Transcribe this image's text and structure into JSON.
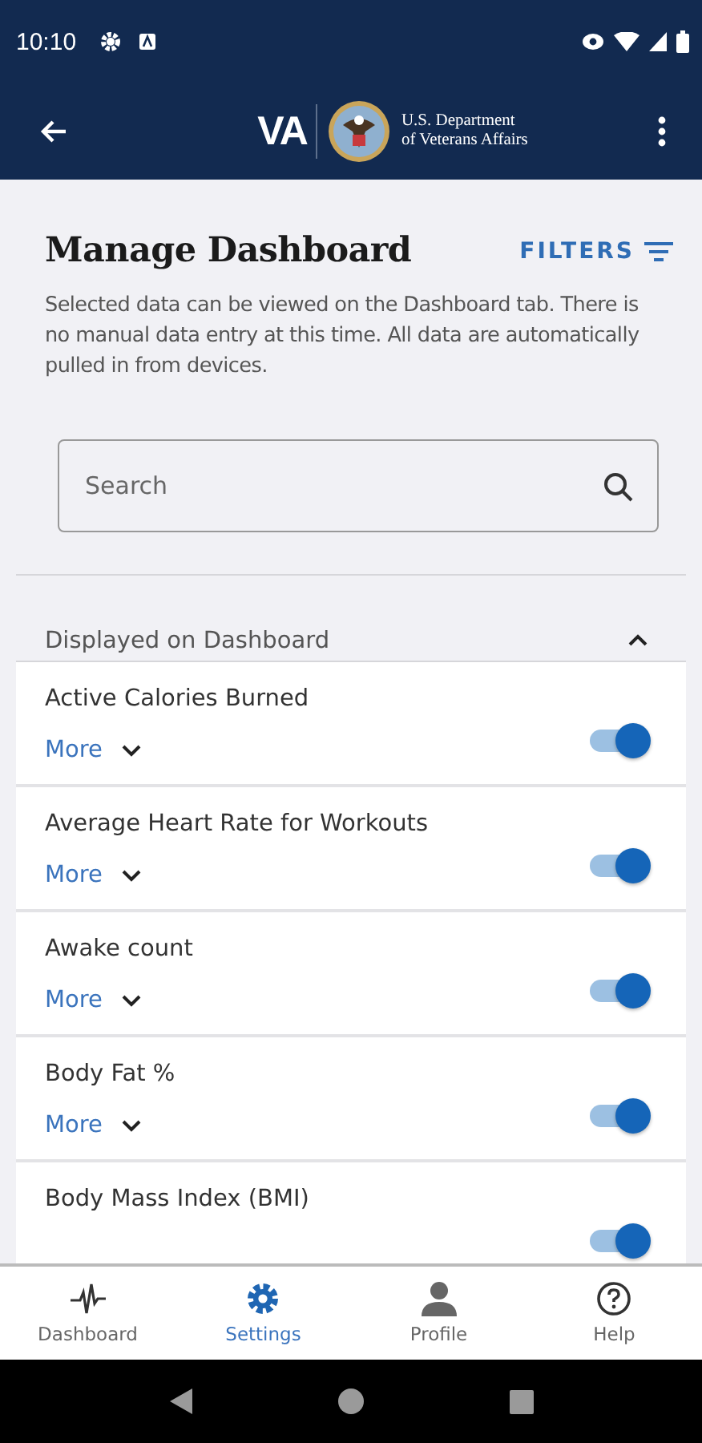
{
  "status_bar": {
    "time": "10:10"
  },
  "app_bar": {
    "logo_text": "VA",
    "department": "U.S. Department",
    "department_line2": "of Veterans Affairs"
  },
  "header": {
    "title": "Manage Dashboard",
    "filters_label": "FILTERS",
    "description": "Selected data can be viewed on the Dashboard tab. There is no manual data entry at this time. All data are automatically pulled in from devices."
  },
  "search": {
    "placeholder": "Search"
  },
  "section": {
    "title": "Displayed on Dashboard",
    "expanded": true
  },
  "items": [
    {
      "label": "Active Calories Burned",
      "more": "More",
      "on": true
    },
    {
      "label": "Average Heart Rate for Workouts",
      "more": "More",
      "on": true
    },
    {
      "label": "Awake count",
      "more": "More",
      "on": true
    },
    {
      "label": "Body Fat %",
      "more": "More",
      "on": true
    },
    {
      "label": "Body Mass Index (BMI)",
      "on": true
    }
  ],
  "bottom_nav": [
    {
      "label": "Dashboard",
      "selected": false
    },
    {
      "label": "Settings",
      "selected": true
    },
    {
      "label": "Profile",
      "selected": false
    },
    {
      "label": "Help",
      "selected": false
    }
  ]
}
